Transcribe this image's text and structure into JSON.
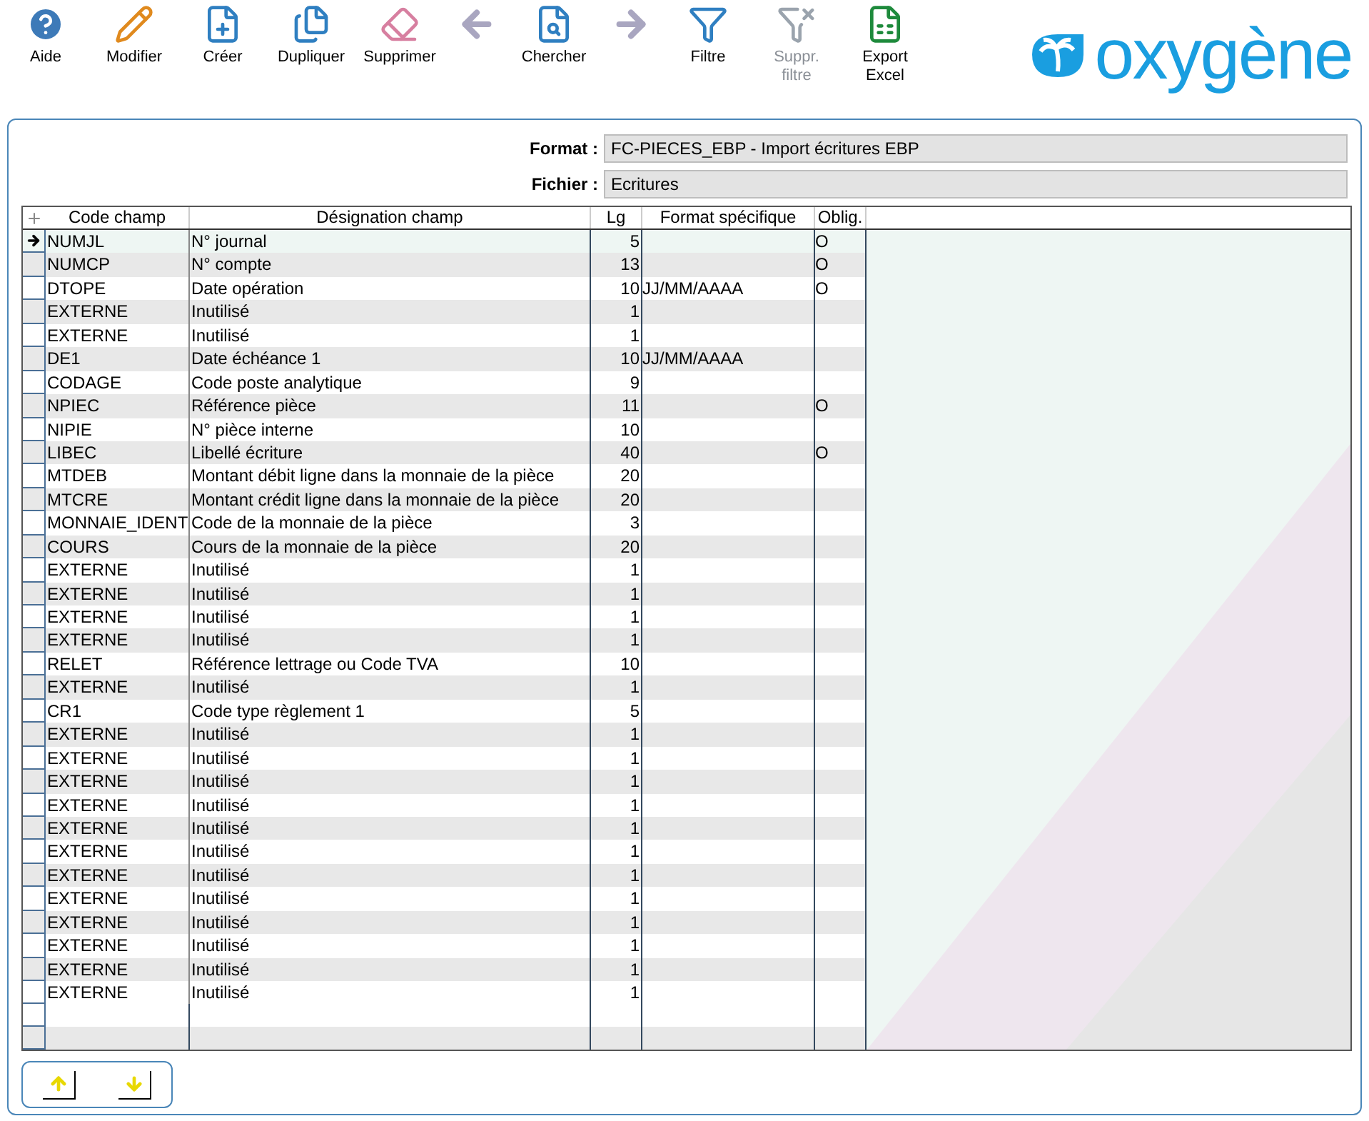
{
  "toolbar": [
    {
      "kind": "help",
      "label": "Aide",
      "disabled": false
    },
    {
      "kind": "edit",
      "label": "Modifier",
      "disabled": false
    },
    {
      "kind": "create",
      "label": "Créer",
      "disabled": false
    },
    {
      "kind": "duplicate",
      "label": "Dupliquer",
      "disabled": false
    },
    {
      "kind": "delete",
      "label": "Supprimer",
      "disabled": false
    },
    {
      "kind": "previous"
    },
    {
      "kind": "search",
      "label": "Chercher",
      "disabled": false
    },
    {
      "kind": "next"
    },
    {
      "kind": "filter",
      "label": "Filtre",
      "disabled": false
    },
    {
      "kind": "clear-filter",
      "label": "Suppr. filtre",
      "disabled": true
    },
    {
      "kind": "export",
      "label": "Export Excel",
      "disabled": false
    }
  ],
  "logo": "oxygène",
  "fields": [
    {
      "label": "Format :",
      "value": "FC-PIECES_EBP - Import écritures EBP"
    },
    {
      "label": "Fichier :",
      "value": "Ecritures"
    }
  ],
  "table": {
    "columns": [
      "Code champ",
      "Désignation champ",
      "Lg",
      "Format spécifique",
      "Oblig."
    ],
    "rows": [
      {
        "cells": [
          "NUMJL",
          "N° journal",
          "5",
          "",
          "O"
        ],
        "selected": true
      },
      {
        "cells": [
          "NUMCP",
          "N° compte",
          "13",
          "",
          "O"
        ],
        "selected": false
      },
      {
        "cells": [
          "DTOPE",
          "Date opération",
          "10",
          "JJ/MM/AAAA",
          "O"
        ],
        "selected": false
      },
      {
        "cells": [
          "EXTERNE",
          "Inutilisé",
          "1",
          "",
          ""
        ],
        "selected": false
      },
      {
        "cells": [
          "EXTERNE",
          "Inutilisé",
          "1",
          "",
          ""
        ],
        "selected": false
      },
      {
        "cells": [
          "DE1",
          "Date échéance 1",
          "10",
          "JJ/MM/AAAA",
          ""
        ],
        "selected": false
      },
      {
        "cells": [
          "CODAGE",
          "Code poste analytique",
          "9",
          "",
          ""
        ],
        "selected": false
      },
      {
        "cells": [
          "NPIEC",
          "Référence pièce",
          "11",
          "",
          "O"
        ],
        "selected": false
      },
      {
        "cells": [
          "NIPIE",
          "N° pièce interne",
          "10",
          "",
          ""
        ],
        "selected": false
      },
      {
        "cells": [
          "LIBEC",
          "Libellé écriture",
          "40",
          "",
          "O"
        ],
        "selected": false
      },
      {
        "cells": [
          "MTDEB",
          "Montant débit ligne dans la monnaie de la pièce",
          "20",
          "",
          ""
        ],
        "selected": false
      },
      {
        "cells": [
          "MTCRE",
          "Montant crédit ligne dans la monnaie de la pièce",
          "20",
          "",
          ""
        ],
        "selected": false
      },
      {
        "cells": [
          "MONNAIE_IDENT",
          "Code de la monnaie de la pièce",
          "3",
          "",
          ""
        ],
        "selected": false
      },
      {
        "cells": [
          "COURS",
          "Cours de la monnaie de la pièce",
          "20",
          "",
          ""
        ],
        "selected": false
      },
      {
        "cells": [
          "EXTERNE",
          "Inutilisé",
          "1",
          "",
          ""
        ],
        "selected": false
      },
      {
        "cells": [
          "EXTERNE",
          "Inutilisé",
          "1",
          "",
          ""
        ],
        "selected": false
      },
      {
        "cells": [
          "EXTERNE",
          "Inutilisé",
          "1",
          "",
          ""
        ],
        "selected": false
      },
      {
        "cells": [
          "EXTERNE",
          "Inutilisé",
          "1",
          "",
          ""
        ],
        "selected": false
      },
      {
        "cells": [
          "RELET",
          "Référence lettrage ou Code TVA",
          "10",
          "",
          ""
        ],
        "selected": false
      },
      {
        "cells": [
          "EXTERNE",
          "Inutilisé",
          "1",
          "",
          ""
        ],
        "selected": false
      },
      {
        "cells": [
          "CR1",
          "Code type règlement 1",
          "5",
          "",
          ""
        ],
        "selected": false
      },
      {
        "cells": [
          "EXTERNE",
          "Inutilisé",
          "1",
          "",
          ""
        ],
        "selected": false
      },
      {
        "cells": [
          "EXTERNE",
          "Inutilisé",
          "1",
          "",
          ""
        ],
        "selected": false
      },
      {
        "cells": [
          "EXTERNE",
          "Inutilisé",
          "1",
          "",
          ""
        ],
        "selected": false
      },
      {
        "cells": [
          "EXTERNE",
          "Inutilisé",
          "1",
          "",
          ""
        ],
        "selected": false
      },
      {
        "cells": [
          "EXTERNE",
          "Inutilisé",
          "1",
          "",
          ""
        ],
        "selected": false
      },
      {
        "cells": [
          "EXTERNE",
          "Inutilisé",
          "1",
          "",
          ""
        ],
        "selected": false
      },
      {
        "cells": [
          "EXTERNE",
          "Inutilisé",
          "1",
          "",
          ""
        ],
        "selected": false
      },
      {
        "cells": [
          "EXTERNE",
          "Inutilisé",
          "1",
          "",
          ""
        ],
        "selected": false
      },
      {
        "cells": [
          "EXTERNE",
          "Inutilisé",
          "1",
          "",
          ""
        ],
        "selected": false
      },
      {
        "cells": [
          "EXTERNE",
          "Inutilisé",
          "1",
          "",
          ""
        ],
        "selected": false
      },
      {
        "cells": [
          "EXTERNE",
          "Inutilisé",
          "1",
          "",
          ""
        ],
        "selected": false
      },
      {
        "cells": [
          "EXTERNE",
          "Inutilisé",
          "1",
          "",
          ""
        ],
        "selected": false
      }
    ]
  }
}
